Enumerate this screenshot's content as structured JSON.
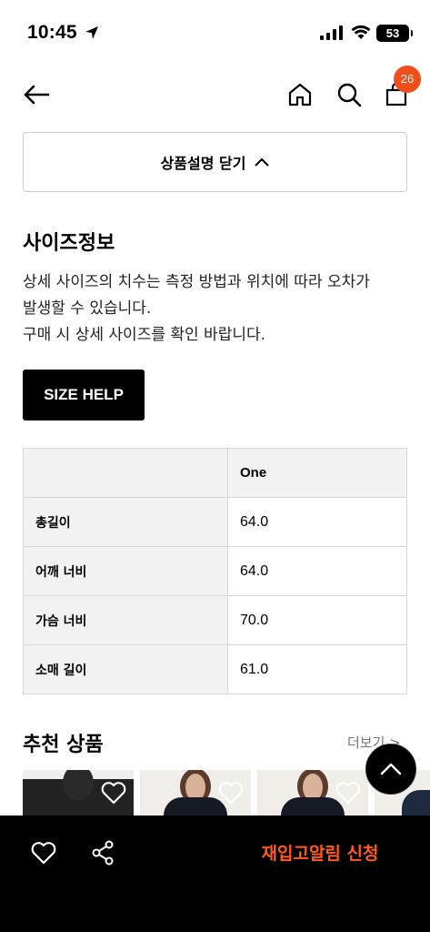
{
  "status_bar": {
    "time": "10:45",
    "battery": "53"
  },
  "nav": {
    "cart_count": "26"
  },
  "collapse_label": "상품설명 닫기",
  "size_info": {
    "title": "사이즈정보",
    "desc_line1": "상세 사이즈의 치수는 측정 방법과 위치에 따라 오차가",
    "desc_line2": "발생할 수 있습니다.",
    "desc_line3": "구매 시 상세 사이즈를 확인 바랍니다.",
    "help_button": "SIZE HELP",
    "table": {
      "columns": [
        "",
        "One"
      ],
      "rows": [
        {
          "label": "총길이",
          "value": "64.0"
        },
        {
          "label": "어깨 너비",
          "value": "64.0"
        },
        {
          "label": "가슴 너비",
          "value": "70.0"
        },
        {
          "label": "소매 길이",
          "value": "61.0"
        }
      ]
    }
  },
  "recommend": {
    "title": "추천 상품",
    "more": "더보기 >"
  },
  "bottom_bar": {
    "restock_button": "재입고알림 신청"
  },
  "colors": {
    "accent": "#f04e1a",
    "restock_text": "#ff5a1f"
  }
}
